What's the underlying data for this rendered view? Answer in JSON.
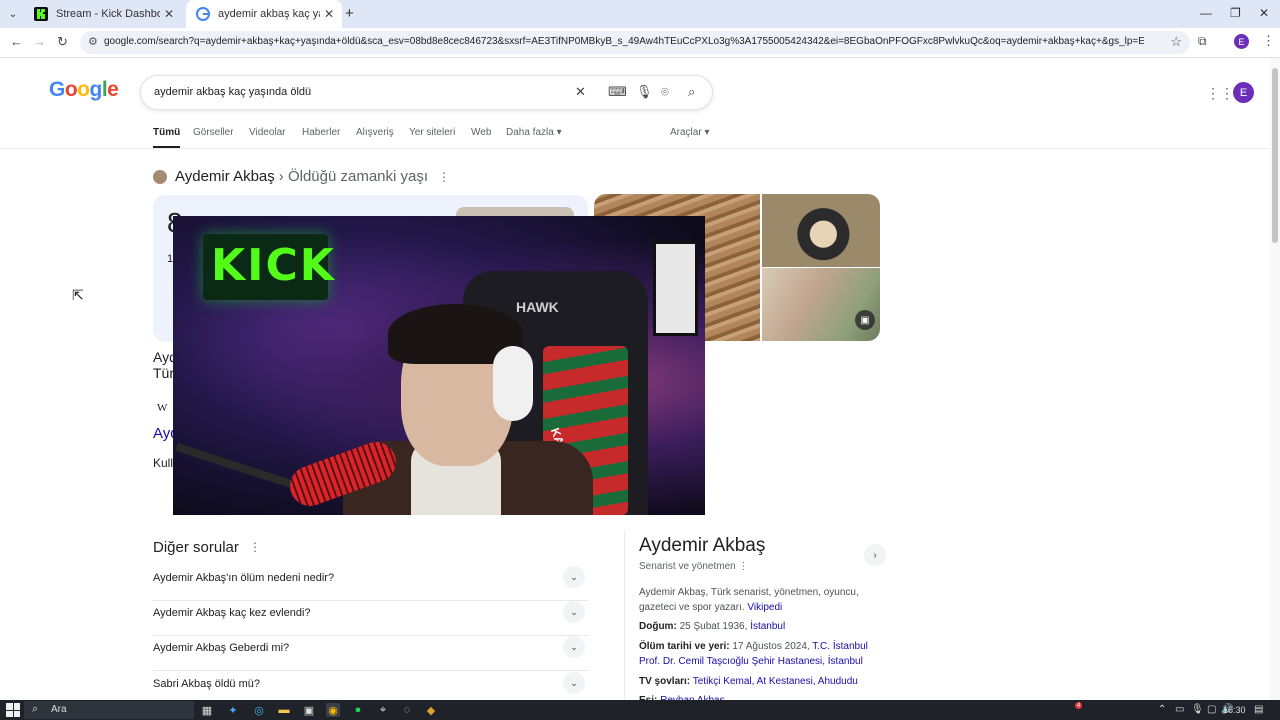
{
  "browser": {
    "tabs": [
      {
        "title": "Stream - Kick Dashboard",
        "favicon": "kick-favicon",
        "active": false
      },
      {
        "title": "aydemir akbaş kaç yaşında öldü",
        "favicon": "google-favicon",
        "active": true
      }
    ],
    "url": "google.com/search?q=aydemir+akbaş+kaç+yaşında+öldü&sca_esv=08bd8e8cec846723&sxsrf=AE3TifNP0MBkyB_s_49Aw4hTEuCcPXLo3g%3A1755005424342&ei=8EGbaOnPFOGFxc8PwlvkuQc&oq=aydemir+akbaş+kaç+&gs_lp=Egxnd3Mtd2l6LXNlcnAiF...",
    "profile_initial": "E"
  },
  "google": {
    "logo": "Google",
    "query": "aydemir akbaş kaç yaşında öldü",
    "tabs": [
      "Tümü",
      "Görseller",
      "Videolar",
      "Haberler",
      "Alışveriş",
      "Yer siteleri",
      "Web",
      "Daha fazla"
    ],
    "tools": "Araçlar",
    "profile_initial": "E"
  },
  "knowledge_header": {
    "entity": "Aydemir Akbaş",
    "crumb": "› Öldüğü zamanki yaşı"
  },
  "partial": {
    "age_fragment": "8",
    "age_sub": "1",
    "l1": "Ayd",
    "l2": "Tür",
    "w": "W",
    "link": "Ayd",
    "kul": "Kull"
  },
  "overlay": {
    "sign_text": "KICK",
    "chair_text": "HAWK",
    "scarf_text": "KARŞIYAKA"
  },
  "related_questions": {
    "title": "Diğer sorular",
    "items": [
      "Aydemir Akbaş'ın ölüm nedeni nedir?",
      "Aydemir Akbaş kaç kez evlendi?",
      "Aydemir Akbaş Geberdi mi?",
      "Sabri Akbaş öldü mü?"
    ]
  },
  "knowledge_panel": {
    "title": "Aydemir Akbaş",
    "subtitle": "Senarist ve yönetmen",
    "description": "Aydemir Akbaş, Türk senarist, yönetmen, oyuncu, gazeteci ve spor yazarı.",
    "description_link": "Vikipedi",
    "facts": [
      {
        "label": "Doğum:",
        "plain": "25 Şubat 1936,",
        "links": "İstanbul"
      },
      {
        "label": "Ölüm tarihi ve yeri:",
        "plain": "17 Ağustos 2024,",
        "links": "T.C. İstanbul Prof. Dr. Cemil Taşcıoğlu Şehir Hastanesi, İstanbul"
      },
      {
        "label": "TV şovları:",
        "plain": "",
        "links": "Tetikçi Kemal, At Kestanesi, Ahududu"
      },
      {
        "label": "Eşi:",
        "plain": "",
        "links": "Reyhan Akbaş"
      }
    ]
  },
  "taskbar": {
    "search_placeholder": "Ara",
    "time": "16:30",
    "notification_count": "4"
  },
  "colors": {
    "link": "#1a0dab",
    "kick_green": "#53fc18",
    "tabbar": "#dfe7f6",
    "profile": "#6a2eb8"
  }
}
